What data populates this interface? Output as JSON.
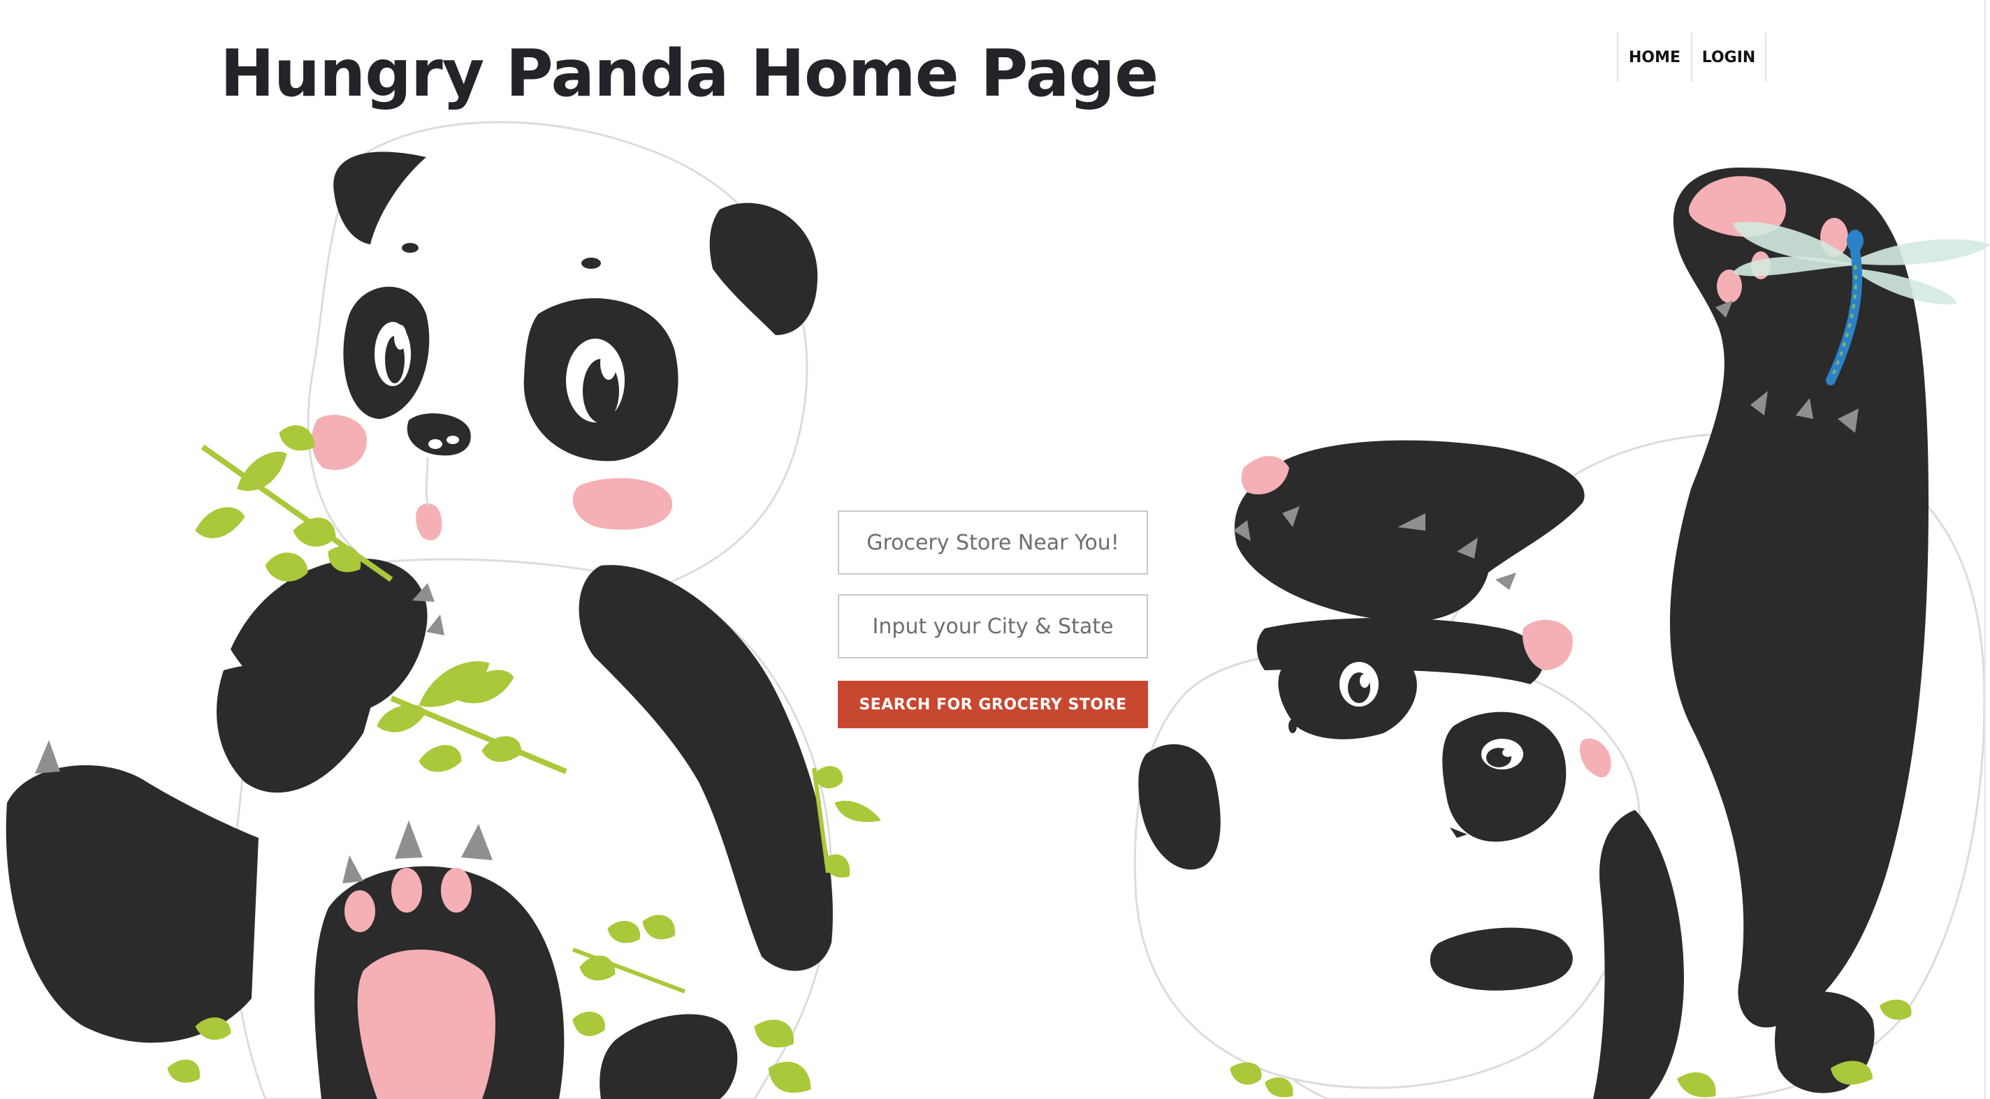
{
  "header": {
    "title": "Hungry Panda Home Page"
  },
  "nav": {
    "home_label": "HOME",
    "login_label": "LOGIN"
  },
  "search": {
    "store_placeholder": "Grocery Store Near You!",
    "location_placeholder": "Input your City & State",
    "button_label": "SEARCH FOR GROCERY STORE"
  },
  "colors": {
    "title_text": "#22242a",
    "button_bg": "#c8472f",
    "button_text": "#ffffff",
    "panda_black": "#2b2b2b",
    "panda_pink": "#f4b0b5",
    "leaf_green": "#a9c93a"
  },
  "illustrations": {
    "left": "panda-eating-leaves",
    "right": "panda-rolling-with-dragonfly"
  }
}
